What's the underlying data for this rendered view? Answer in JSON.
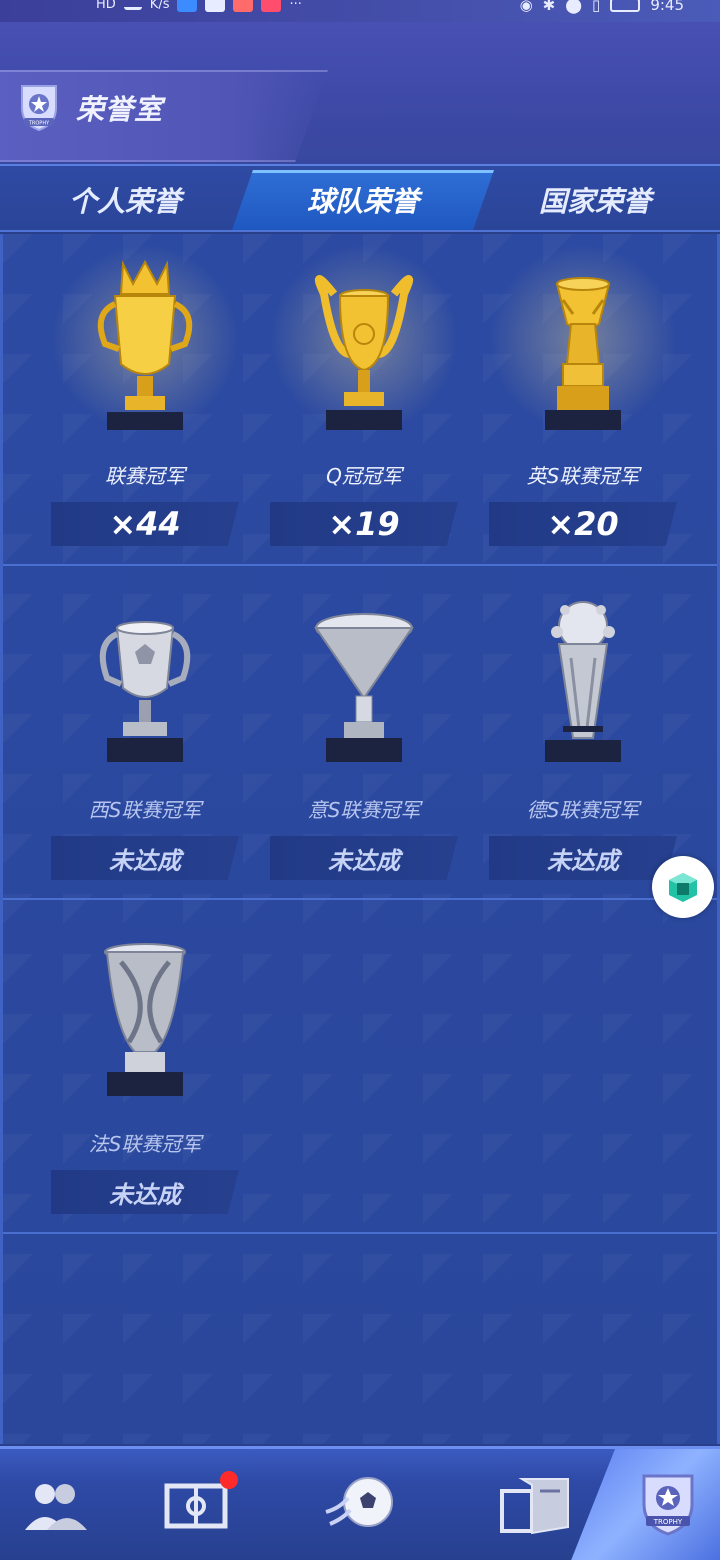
{
  "status_bar": {
    "hd": "HD",
    "speed_unit": "K/s",
    "time": "9:45",
    "more": "···"
  },
  "header": {
    "title": "荣誉室",
    "badge_text": "TROPHY"
  },
  "tabs": [
    {
      "label": "个人荣誉",
      "active": false
    },
    {
      "label": "球队荣誉",
      "active": true
    },
    {
      "label": "国家荣誉",
      "active": false
    }
  ],
  "trophies": [
    {
      "name": "联赛冠军",
      "count": "×44",
      "achieved": true,
      "color": "#f3c233"
    },
    {
      "name": "Q冠冠军",
      "count": "×19",
      "achieved": true,
      "color": "#f3c233"
    },
    {
      "name": "英S联赛冠军",
      "count": "×20",
      "achieved": true,
      "color": "#f3c233"
    },
    {
      "name": "西S联赛冠军",
      "count": "未达成",
      "achieved": false,
      "color": "#c9ccd6"
    },
    {
      "name": "意S联赛冠军",
      "count": "未达成",
      "achieved": false,
      "color": "#c9ccd6"
    },
    {
      "name": "德S联赛冠军",
      "count": "未达成",
      "achieved": false,
      "color": "#c9ccd6"
    },
    {
      "name": "法S联赛冠军",
      "count": "未达成",
      "achieved": false,
      "color": "#c9ccd6"
    }
  ],
  "bottom_nav": {
    "items": [
      "players-icon",
      "pitch-icon",
      "football-icon",
      "card-icon",
      "trophy-icon"
    ],
    "active": "trophy-icon",
    "trophy_badge_text": "TROPHY"
  },
  "colors": {
    "accent": "#2f6fd6",
    "background": "#2a479c",
    "gold": "#f3c233",
    "silver": "#c9ccd6"
  }
}
